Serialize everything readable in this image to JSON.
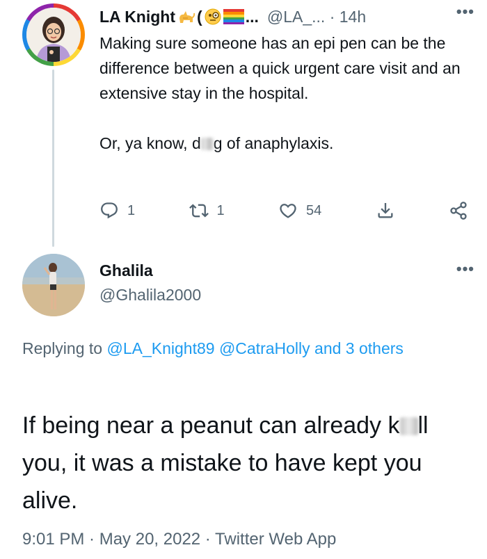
{
  "tweet": {
    "author_name": "LA Knight",
    "name_suffix": "(",
    "name_ellipsis": "...",
    "handle": "@LA_...",
    "time": "· 14h",
    "more": "•••",
    "body_line1_a": "Making sure someone has an epi pen can be the difference between a quick urgent care visit and an extensive stay in the hospital.",
    "body_line2_a": "Or, ya know, d",
    "body_line2_b": "g of anaphylaxis.",
    "actions": {
      "reply_count": "1",
      "retweet_count": "1",
      "like_count": "54"
    },
    "icons": [
      "cat-emoji-icon",
      "monocle-face-emoji-icon",
      "rainbow-flag-emoji-icon",
      "reply-icon",
      "retweet-icon",
      "heart-icon",
      "bookmark-icon",
      "share-icon"
    ]
  },
  "reply": {
    "author_name": "Ghalila",
    "handle": "@Ghalila2000",
    "more": "•••",
    "replying_prefix": "Replying to",
    "mention1": "@LA_Knight89",
    "mention2": "@CatraHolly",
    "mention_rest": "and 3 others",
    "body_a": "If being near a peanut can already k",
    "body_b": "ll you, it was a mistake to have kept you alive.",
    "meta": "9:01 PM · May 20, 2022 · Twitter Web App"
  },
  "colors": {
    "text": "#0f1419",
    "muted": "#536471",
    "link": "#1d9bf0",
    "thread_line": "#cfd9de"
  }
}
